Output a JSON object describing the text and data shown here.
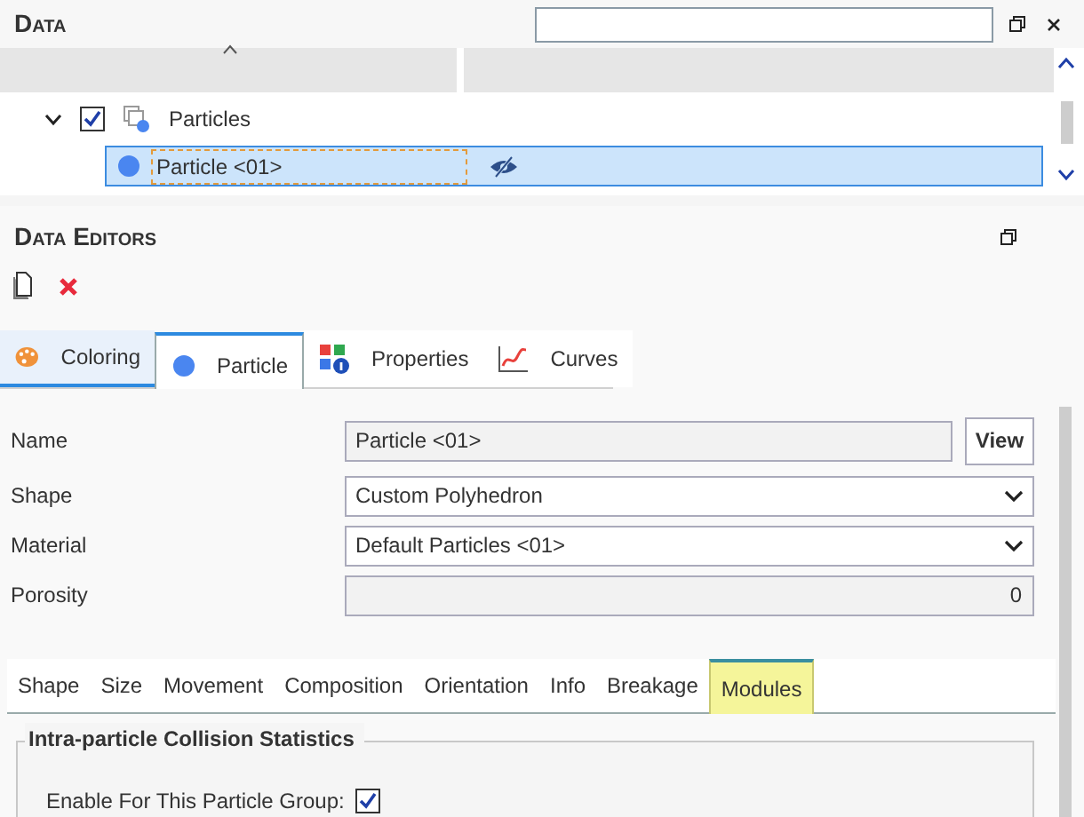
{
  "data_panel": {
    "title": "Data",
    "tree": [
      {
        "label": "Particles",
        "checked": true,
        "expanded": true,
        "children": [
          {
            "label": "Particle <01>",
            "selected": true
          }
        ]
      }
    ]
  },
  "editors_panel": {
    "title": "Data Editors",
    "tabs": [
      {
        "label": "Coloring",
        "kind": "palette",
        "selected": false
      },
      {
        "label": "Particle",
        "kind": "dot",
        "selected": true
      },
      {
        "label": "Properties",
        "kind": "grid",
        "selected": false
      },
      {
        "label": "Curves",
        "kind": "curve",
        "selected": false
      }
    ],
    "fields": [
      {
        "kind": "text",
        "label": "Name",
        "value": "Particle <01>",
        "button": "View"
      },
      {
        "kind": "select",
        "label": "Shape",
        "value": "Custom Polyhedron"
      },
      {
        "kind": "select",
        "label": "Material",
        "value": "Default Particles <01>"
      },
      {
        "kind": "number",
        "label": "Porosity",
        "value": "0"
      }
    ],
    "subtabs": [
      {
        "label": "Shape",
        "selected": false
      },
      {
        "label": "Size",
        "selected": false
      },
      {
        "label": "Movement",
        "selected": false
      },
      {
        "label": "Composition",
        "selected": false
      },
      {
        "label": "Orientation",
        "selected": false
      },
      {
        "label": "Info",
        "selected": false
      },
      {
        "label": "Breakage",
        "selected": false
      },
      {
        "label": "Modules",
        "selected": true
      }
    ],
    "group": {
      "title": "Intra-particle Collision Statistics",
      "option": {
        "label": "Enable For This Particle Group:",
        "checked": true
      }
    }
  }
}
